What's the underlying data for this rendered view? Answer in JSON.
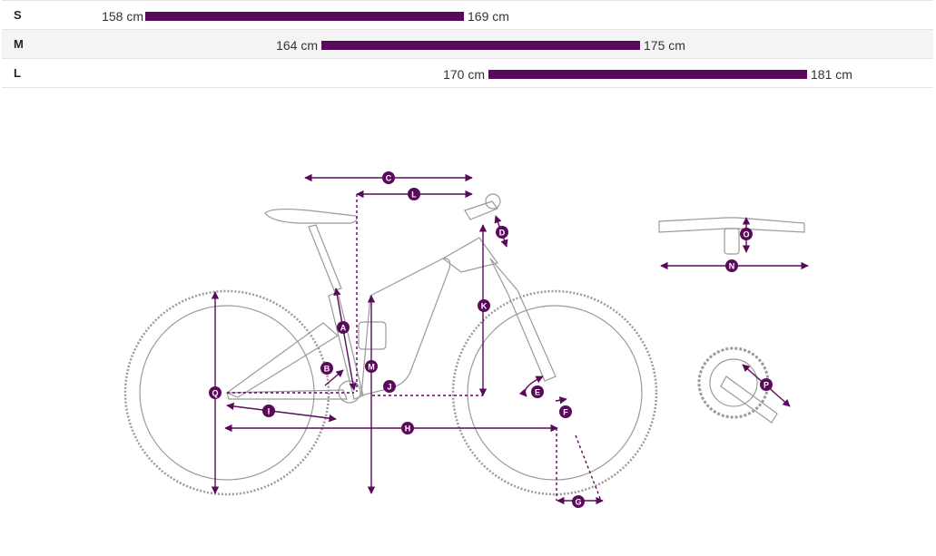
{
  "sizes": [
    {
      "name": "S",
      "min": "158 cm",
      "max": "169 cm"
    },
    {
      "name": "M",
      "min": "164 cm",
      "max": "175 cm"
    },
    {
      "name": "L",
      "min": "170 cm",
      "max": "181 cm"
    }
  ],
  "colors": {
    "accent": "#5a0a5a",
    "outline": "#9a9a9a",
    "row_alt": "#f4f4f4"
  },
  "labels": {
    "A": "A",
    "B": "B",
    "C": "C",
    "D": "D",
    "E": "E",
    "F": "F",
    "G": "G",
    "H": "H",
    "I": "I",
    "J": "J",
    "K": "K",
    "L": "L",
    "M": "M",
    "N": "N",
    "O": "O",
    "P": "P",
    "Q": "Q"
  }
}
